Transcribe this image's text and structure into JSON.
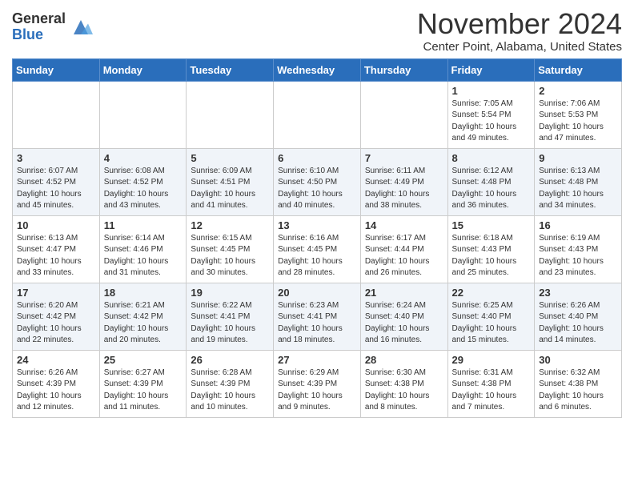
{
  "header": {
    "logo_general": "General",
    "logo_blue": "Blue",
    "month_title": "November 2024",
    "location": "Center Point, Alabama, United States"
  },
  "days_of_week": [
    "Sunday",
    "Monday",
    "Tuesday",
    "Wednesday",
    "Thursday",
    "Friday",
    "Saturday"
  ],
  "weeks": [
    [
      {
        "day": "",
        "info": ""
      },
      {
        "day": "",
        "info": ""
      },
      {
        "day": "",
        "info": ""
      },
      {
        "day": "",
        "info": ""
      },
      {
        "day": "",
        "info": ""
      },
      {
        "day": "1",
        "info": "Sunrise: 7:05 AM\nSunset: 5:54 PM\nDaylight: 10 hours and 49 minutes."
      },
      {
        "day": "2",
        "info": "Sunrise: 7:06 AM\nSunset: 5:53 PM\nDaylight: 10 hours and 47 minutes."
      }
    ],
    [
      {
        "day": "3",
        "info": "Sunrise: 6:07 AM\nSunset: 4:52 PM\nDaylight: 10 hours and 45 minutes."
      },
      {
        "day": "4",
        "info": "Sunrise: 6:08 AM\nSunset: 4:52 PM\nDaylight: 10 hours and 43 minutes."
      },
      {
        "day": "5",
        "info": "Sunrise: 6:09 AM\nSunset: 4:51 PM\nDaylight: 10 hours and 41 minutes."
      },
      {
        "day": "6",
        "info": "Sunrise: 6:10 AM\nSunset: 4:50 PM\nDaylight: 10 hours and 40 minutes."
      },
      {
        "day": "7",
        "info": "Sunrise: 6:11 AM\nSunset: 4:49 PM\nDaylight: 10 hours and 38 minutes."
      },
      {
        "day": "8",
        "info": "Sunrise: 6:12 AM\nSunset: 4:48 PM\nDaylight: 10 hours and 36 minutes."
      },
      {
        "day": "9",
        "info": "Sunrise: 6:13 AM\nSunset: 4:48 PM\nDaylight: 10 hours and 34 minutes."
      }
    ],
    [
      {
        "day": "10",
        "info": "Sunrise: 6:13 AM\nSunset: 4:47 PM\nDaylight: 10 hours and 33 minutes."
      },
      {
        "day": "11",
        "info": "Sunrise: 6:14 AM\nSunset: 4:46 PM\nDaylight: 10 hours and 31 minutes."
      },
      {
        "day": "12",
        "info": "Sunrise: 6:15 AM\nSunset: 4:45 PM\nDaylight: 10 hours and 30 minutes."
      },
      {
        "day": "13",
        "info": "Sunrise: 6:16 AM\nSunset: 4:45 PM\nDaylight: 10 hours and 28 minutes."
      },
      {
        "day": "14",
        "info": "Sunrise: 6:17 AM\nSunset: 4:44 PM\nDaylight: 10 hours and 26 minutes."
      },
      {
        "day": "15",
        "info": "Sunrise: 6:18 AM\nSunset: 4:43 PM\nDaylight: 10 hours and 25 minutes."
      },
      {
        "day": "16",
        "info": "Sunrise: 6:19 AM\nSunset: 4:43 PM\nDaylight: 10 hours and 23 minutes."
      }
    ],
    [
      {
        "day": "17",
        "info": "Sunrise: 6:20 AM\nSunset: 4:42 PM\nDaylight: 10 hours and 22 minutes."
      },
      {
        "day": "18",
        "info": "Sunrise: 6:21 AM\nSunset: 4:42 PM\nDaylight: 10 hours and 20 minutes."
      },
      {
        "day": "19",
        "info": "Sunrise: 6:22 AM\nSunset: 4:41 PM\nDaylight: 10 hours and 19 minutes."
      },
      {
        "day": "20",
        "info": "Sunrise: 6:23 AM\nSunset: 4:41 PM\nDaylight: 10 hours and 18 minutes."
      },
      {
        "day": "21",
        "info": "Sunrise: 6:24 AM\nSunset: 4:40 PM\nDaylight: 10 hours and 16 minutes."
      },
      {
        "day": "22",
        "info": "Sunrise: 6:25 AM\nSunset: 4:40 PM\nDaylight: 10 hours and 15 minutes."
      },
      {
        "day": "23",
        "info": "Sunrise: 6:26 AM\nSunset: 4:40 PM\nDaylight: 10 hours and 14 minutes."
      }
    ],
    [
      {
        "day": "24",
        "info": "Sunrise: 6:26 AM\nSunset: 4:39 PM\nDaylight: 10 hours and 12 minutes."
      },
      {
        "day": "25",
        "info": "Sunrise: 6:27 AM\nSunset: 4:39 PM\nDaylight: 10 hours and 11 minutes."
      },
      {
        "day": "26",
        "info": "Sunrise: 6:28 AM\nSunset: 4:39 PM\nDaylight: 10 hours and 10 minutes."
      },
      {
        "day": "27",
        "info": "Sunrise: 6:29 AM\nSunset: 4:39 PM\nDaylight: 10 hours and 9 minutes."
      },
      {
        "day": "28",
        "info": "Sunrise: 6:30 AM\nSunset: 4:38 PM\nDaylight: 10 hours and 8 minutes."
      },
      {
        "day": "29",
        "info": "Sunrise: 6:31 AM\nSunset: 4:38 PM\nDaylight: 10 hours and 7 minutes."
      },
      {
        "day": "30",
        "info": "Sunrise: 6:32 AM\nSunset: 4:38 PM\nDaylight: 10 hours and 6 minutes."
      }
    ]
  ]
}
